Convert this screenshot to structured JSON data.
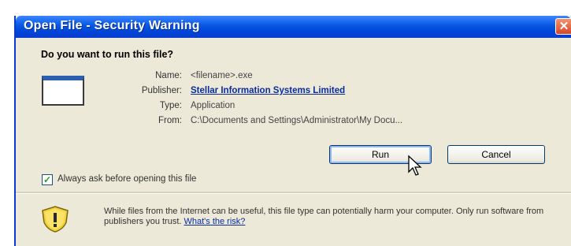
{
  "dialog": {
    "title": "Open File - Security Warning",
    "close_glyph": "✕",
    "question": "Do you want to run this file?",
    "file_icon": "file-window-icon",
    "fields": {
      "name_label": "Name:",
      "name_value": "<filename>.exe",
      "publisher_label": "Publisher:",
      "publisher_value": "Stellar Information Systems Limited",
      "type_label": "Type:",
      "type_value": "Application",
      "from_label": "From:",
      "from_value": "C:\\Documents and Settings\\Administrator\\My Docu..."
    },
    "buttons": {
      "run": "Run",
      "cancel": "Cancel"
    },
    "checkbox": {
      "checked": true,
      "label": "Always ask before opening this file"
    },
    "warning": {
      "icon": "shield-warning-icon",
      "text": "While files from the Internet can be useful, this file type can potentially harm your computer. Only run software from publishers you trust.",
      "link": "What's the risk?"
    }
  },
  "colors": {
    "titlebar": "#0a5be6",
    "face": "#ece9d8",
    "link": "#0a2c9c"
  }
}
